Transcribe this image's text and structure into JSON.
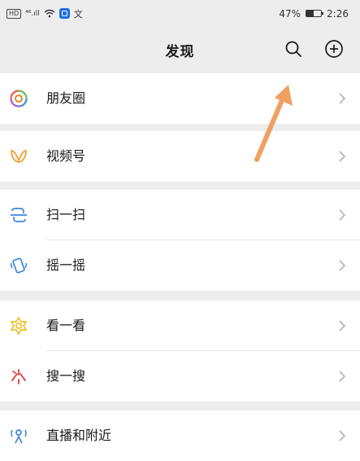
{
  "status_bar": {
    "hd": "HD",
    "signal": "⁴⁶.ıll",
    "ime": "文",
    "battery_percent": "47%",
    "battery_level": 0.47,
    "time": "2:26"
  },
  "header": {
    "title": "发现",
    "search_icon": "search-icon",
    "add_icon": "plus-circle-icon"
  },
  "menu": {
    "moments": "朋友圈",
    "channels": "视频号",
    "scan": "扫一扫",
    "shake": "摇一摇",
    "top_stories": "看一看",
    "search": "搜一搜",
    "live_nearby": "直播和附近"
  },
  "annotation": {
    "color": "#f0a060",
    "points_to": "search-icon"
  }
}
